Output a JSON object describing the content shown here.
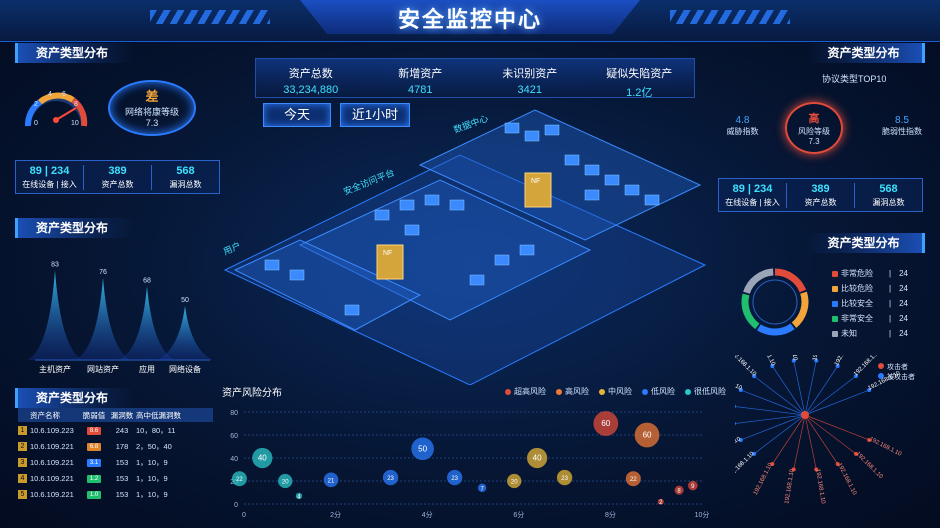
{
  "header": {
    "title": "安全监控中心"
  },
  "top_stats": [
    {
      "label": "资产总数",
      "value": "33,234,880"
    },
    {
      "label": "新增资产",
      "value": "4781"
    },
    {
      "label": "未识别资产",
      "value": "3421"
    },
    {
      "label": "疑似失陷资产",
      "value": "1.2亿"
    }
  ],
  "time_buttons": {
    "today": "今天",
    "last_hour": "近1小时"
  },
  "left": {
    "panel1": {
      "title": "资产类型分布",
      "gauge": {
        "ticks": [
          "0",
          "2",
          "4",
          "6",
          "8",
          "10"
        ],
        "value": 7.3
      },
      "health": {
        "grade": "差",
        "label": "网络将康等级",
        "value": "7.3"
      },
      "stats": [
        {
          "value": "89 | 234",
          "label": "在线设备 | 接入"
        },
        {
          "value": "389",
          "label": "资产总数"
        },
        {
          "value": "568",
          "label": "漏洞总数"
        }
      ]
    },
    "panel2": {
      "title": "资产类型分布",
      "chart_data": {
        "type": "area",
        "categories": [
          "主机资产",
          "网站资产",
          "应用",
          "网络设备"
        ],
        "values": [
          83,
          76,
          68,
          50
        ]
      }
    },
    "panel3": {
      "title": "资产类型分布",
      "columns": [
        "资产名称",
        "脆弱值",
        "漏洞数",
        "高中低漏洞数"
      ],
      "rows": [
        {
          "rank": "1",
          "ip": "10.6.109.223",
          "vuln": "8.6",
          "color": "#e04b3a",
          "count": "243",
          "levels": "10，80，11"
        },
        {
          "rank": "2",
          "ip": "10.6.109.221",
          "vuln": "6.8",
          "color": "#e0842c",
          "count": "178",
          "levels": "2，50，40"
        },
        {
          "rank": "3",
          "ip": "10.6.109.221",
          "vuln": "3.1",
          "color": "#2a7bff",
          "count": "153",
          "levels": "1，10，9"
        },
        {
          "rank": "4",
          "ip": "10.6.109.221",
          "vuln": "1.2",
          "color": "#1fbf6e",
          "count": "153",
          "levels": "1，10，9"
        },
        {
          "rank": "5",
          "ip": "10.6.109.221",
          "vuln": "1.0",
          "color": "#1fbf6e",
          "count": "153",
          "levels": "1，10，9"
        }
      ]
    }
  },
  "right": {
    "panel1": {
      "title": "资产类型分布",
      "subtitle": "协议类型TOP10",
      "threat": {
        "value": "4.8",
        "label": "威胁指数"
      },
      "risk": {
        "grade": "高",
        "label": "风险等级",
        "value": "7.3"
      },
      "vuln": {
        "value": "8.5",
        "label": "脆弱性指数"
      },
      "stats": [
        {
          "value": "89 | 234",
          "label": "在线设备 | 接入"
        },
        {
          "value": "389",
          "label": "资产总数"
        },
        {
          "value": "568",
          "label": "漏洞总数"
        }
      ]
    },
    "panel2": {
      "title": "资产类型分布",
      "chart_data": {
        "type": "pie",
        "categories": [
          "非常危险",
          "比较危险",
          "比较安全",
          "非常安全",
          "未知"
        ],
        "values": [
          24,
          24,
          24,
          24,
          24
        ],
        "colors": [
          "#e04b3a",
          "#f2a53a",
          "#2a7bff",
          "#1fbf6e",
          "#9aa6b8"
        ]
      }
    },
    "attack_graph": {
      "legend": [
        "攻击者",
        "被攻击者"
      ],
      "ip": "192.168.1.10"
    }
  },
  "risk_chart": {
    "title": "资产风险分布",
    "legend": [
      {
        "name": "超高风险",
        "color": "#e04b3a"
      },
      {
        "name": "高风险",
        "color": "#f07a34"
      },
      {
        "name": "中风险",
        "color": "#e6b536"
      },
      {
        "name": "低风险",
        "color": "#2a7bff"
      },
      {
        "name": "很低风险",
        "color": "#2bc7c9"
      }
    ],
    "chart_data": {
      "type": "scatter",
      "y_ticks": [
        "0",
        "20",
        "40",
        "60",
        "80"
      ],
      "x_ticks": [
        "0",
        "2分",
        "4分",
        "6分",
        "8分",
        "10分"
      ],
      "xlim": [
        0,
        10
      ],
      "ylim": [
        0,
        80
      ],
      "points": [
        {
          "x": -0.1,
          "y": 22,
          "v": "22",
          "c": "#2bc7c9"
        },
        {
          "x": 0.4,
          "y": 40,
          "v": "40",
          "c": "#2bc7c9"
        },
        {
          "x": 0.9,
          "y": 20,
          "v": "20",
          "c": "#2bc7c9"
        },
        {
          "x": 1.2,
          "y": 7,
          "v": "4",
          "c": "#2bc7c9"
        },
        {
          "x": 1.9,
          "y": 21,
          "v": "21",
          "c": "#2a7bff"
        },
        {
          "x": 3.2,
          "y": 23,
          "v": "23",
          "c": "#2a7bff"
        },
        {
          "x": 3.9,
          "y": 48,
          "v": "50",
          "c": "#2a7bff"
        },
        {
          "x": 4.6,
          "y": 23,
          "v": "23",
          "c": "#2a7bff"
        },
        {
          "x": 5.2,
          "y": 14,
          "v": "7",
          "c": "#2a7bff"
        },
        {
          "x": 5.9,
          "y": 20,
          "v": "20",
          "c": "#e6b536"
        },
        {
          "x": 6.4,
          "y": 40,
          "v": "40",
          "c": "#e6b536"
        },
        {
          "x": 7.0,
          "y": 23,
          "v": "23",
          "c": "#e6b536"
        },
        {
          "x": 8.5,
          "y": 22,
          "v": "22",
          "c": "#f07a34"
        },
        {
          "x": 8.8,
          "y": 60,
          "v": "60",
          "c": "#f07a34"
        },
        {
          "x": 7.9,
          "y": 70,
          "v": "60",
          "c": "#e04b3a"
        },
        {
          "x": 9.1,
          "y": 2,
          "v": "2",
          "c": "#e04b3a"
        },
        {
          "x": 9.5,
          "y": 12,
          "v": "8",
          "c": "#e04b3a"
        },
        {
          "x": 9.8,
          "y": 16,
          "v": "9",
          "c": "#e04b3a"
        }
      ]
    }
  },
  "topology": {
    "zones": [
      "数据中心",
      "安全访问平台",
      "用户"
    ],
    "nf_label": "NF"
  }
}
